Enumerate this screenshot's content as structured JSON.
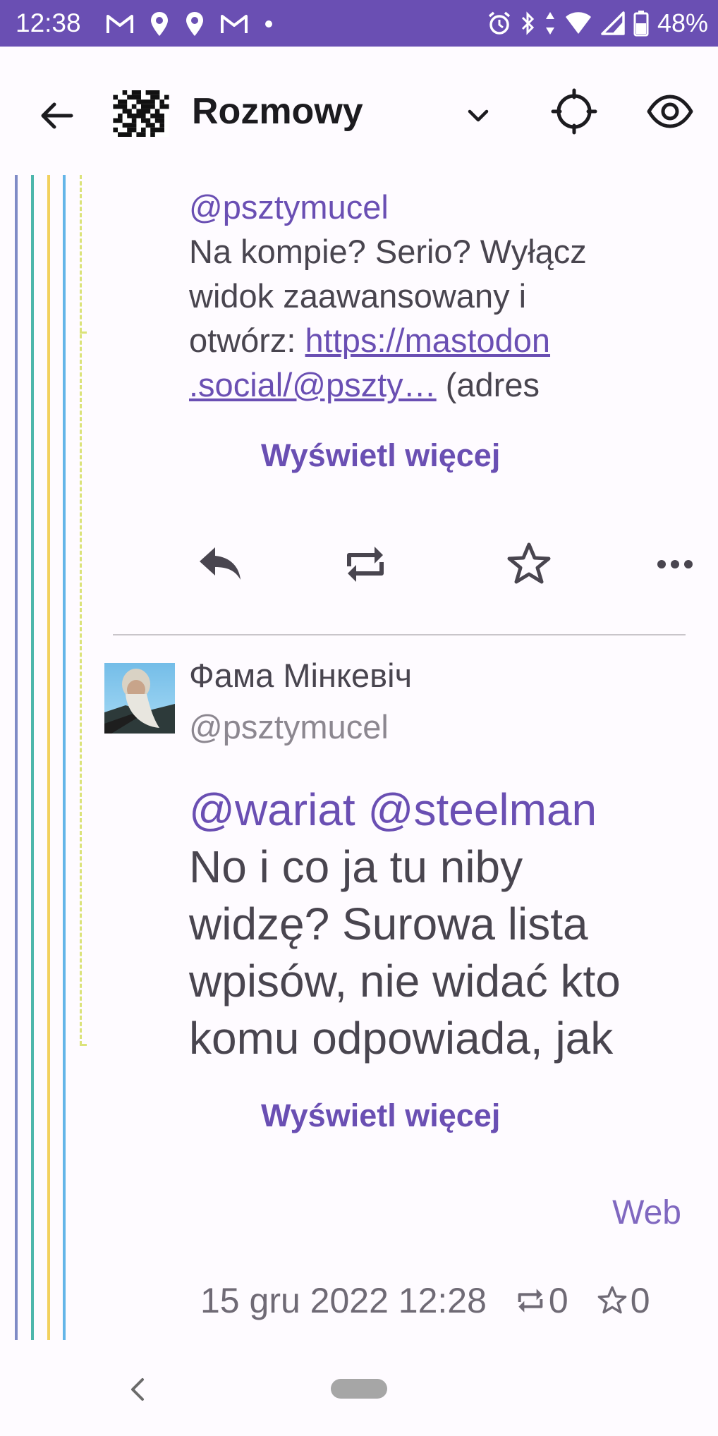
{
  "status_bar": {
    "time": "12:38",
    "battery": "48%",
    "background_color": "#6a4fb3",
    "left_icons": [
      "gmail-icon",
      "location-pin-icon",
      "location-pin-icon",
      "gmail-icon",
      "dot-icon"
    ],
    "right_icons": [
      "alarm-icon",
      "bluetooth-icon",
      "data-arrows-icon",
      "wifi-icon",
      "signal-icon",
      "battery-icon"
    ]
  },
  "toolbar": {
    "title": "Rozmowy",
    "back_icon": "arrow-left-icon",
    "dropdown_icon": "chevron-down-icon",
    "locate_icon": "crosshair-icon",
    "visibility_icon": "eye-icon"
  },
  "thread_line_colors": [
    "#7f8bc6",
    "#4db6ac",
    "#f2d15e",
    "#64b5e8"
  ],
  "post1": {
    "mention": "@psztymucel",
    "text_line1": "Na kompie? Serio? Wyłącz",
    "text_line2": "widok zaawansowany i",
    "text_line3_prefix": "otwórz: ",
    "link_part1": "https://mastodon",
    "link_part2": ".social/@pszty…",
    "text_after_link": " (adres",
    "show_more": "Wyświetl więcej"
  },
  "actions": {
    "reply_icon": "reply-icon",
    "boost_icon": "repeat-icon",
    "favourite_icon": "star-icon",
    "more_icon": "more-horizontal-icon"
  },
  "post2": {
    "display_name": "Фама Мінкевіч",
    "handle": "@psztymucel",
    "mentions": "@wariat @steelman",
    "text_line1": "No i co ja tu niby",
    "text_line2": "widzę? Surowa lista",
    "text_line3": "wpisów, nie widać kto",
    "text_line4": "komu odpowiada, jak",
    "show_more": "Wyświetl więcej",
    "application": "Web",
    "timestamp": "15 gru 2022 12:28",
    "boosts": "0",
    "favourites": "0"
  },
  "accent_color": "#6a4fb3"
}
